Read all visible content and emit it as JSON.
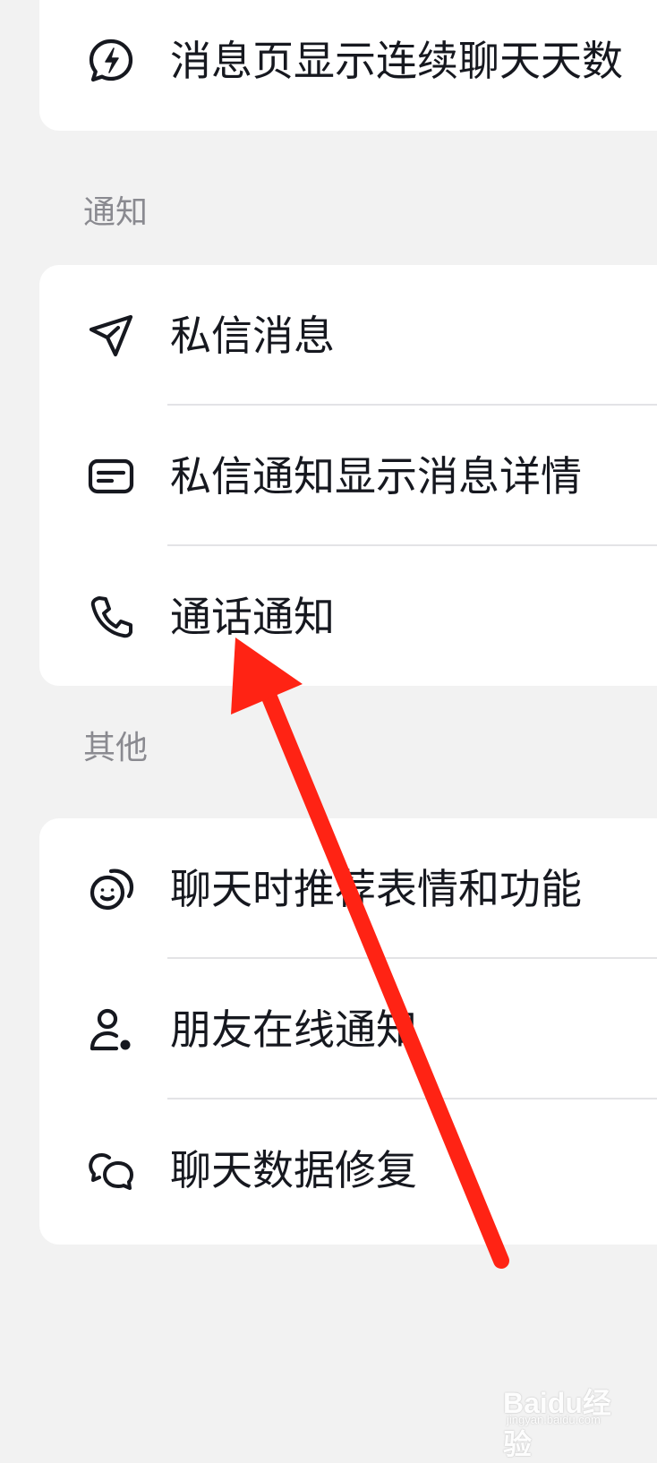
{
  "top_group": {
    "items": [
      {
        "label": "消息页显示连续聊天天数",
        "icon": "lightning-bubble-icon"
      }
    ]
  },
  "notification_section": {
    "title": "通知",
    "items": [
      {
        "label": "私信消息",
        "icon": "paper-plane-icon"
      },
      {
        "label": "私信通知显示消息详情",
        "icon": "message-card-icon"
      },
      {
        "label": "通话通知",
        "icon": "phone-icon"
      }
    ]
  },
  "other_section": {
    "title": "其他",
    "items": [
      {
        "label": "聊天时推荐表情和功能",
        "icon": "smiley-bubble-icon"
      },
      {
        "label": "朋友在线通知",
        "icon": "user-online-icon"
      },
      {
        "label": "聊天数据修复",
        "icon": "chat-bubbles-icon"
      }
    ]
  },
  "annotation": {
    "arrow_color": "#ff2314",
    "points_to": "通话通知"
  },
  "watermark": {
    "logo": "Baidu经验",
    "sub": "jingyan.baidu.com"
  }
}
